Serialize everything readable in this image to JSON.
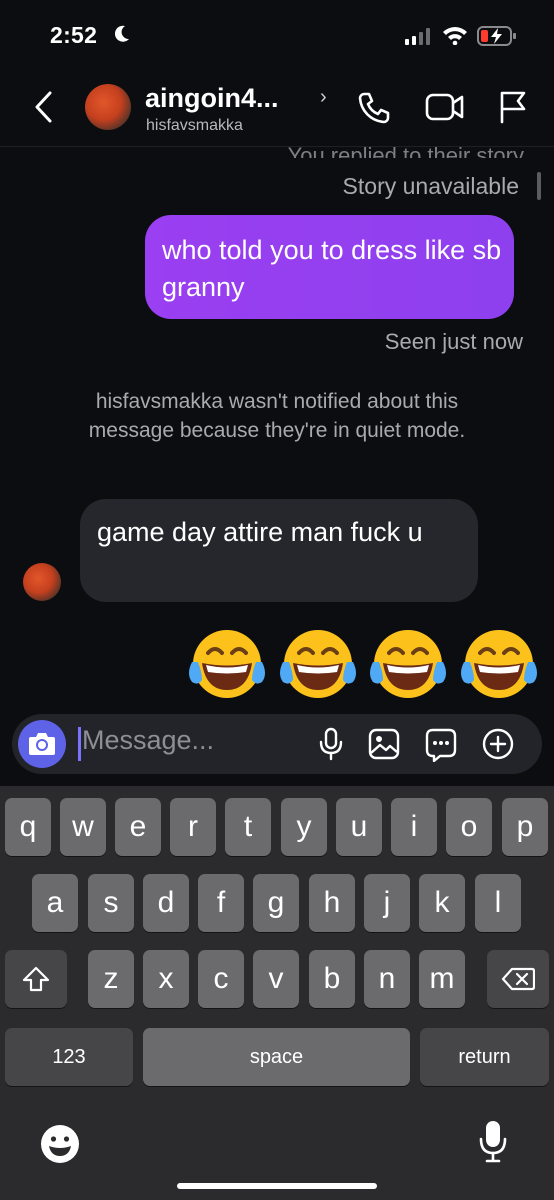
{
  "status_bar": {
    "time": "2:52"
  },
  "header": {
    "contact_name": "aingoin4...",
    "contact_handle": "hisfavsmakka",
    "chevron": "›",
    "icons": [
      "back-icon",
      "phone-icon",
      "video-icon",
      "flag-icon"
    ]
  },
  "chat": {
    "replied_note": "You replied to their story",
    "story_unavailable": "Story unavailable",
    "outgoing_message": "who told you to dress like sb granny",
    "seen_status": "Seen just now",
    "quiet_mode_note": "hisfavsmakka wasn't notified about this message because they're in quiet mode.",
    "incoming_message": "game day attire man fuck u",
    "emoji_message": [
      "😂",
      "😂",
      "😂",
      "😂"
    ]
  },
  "composer": {
    "placeholder": "Message...",
    "icons": [
      "camera-icon",
      "microphone-icon",
      "gallery-icon",
      "sticker-icon",
      "plus-icon"
    ]
  },
  "keyboard": {
    "row1": [
      "q",
      "w",
      "e",
      "r",
      "t",
      "y",
      "u",
      "i",
      "o",
      "p"
    ],
    "row2": [
      "a",
      "s",
      "d",
      "f",
      "g",
      "h",
      "j",
      "k",
      "l"
    ],
    "row3": [
      "z",
      "x",
      "c",
      "v",
      "b",
      "n",
      "m"
    ],
    "numbers_label": "123",
    "space_label": "space",
    "return_label": "return"
  },
  "colors": {
    "background": "#0c0d11",
    "outgoing_bubble": "#9a3ff1",
    "incoming_bubble": "#26272d",
    "camera_button": "#5d62e6"
  }
}
